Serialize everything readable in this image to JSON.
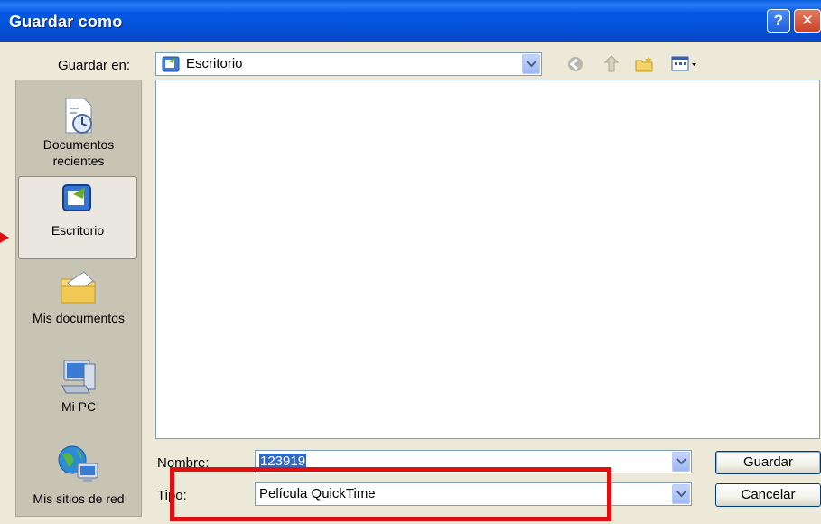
{
  "window": {
    "title": "Guardar como"
  },
  "toolbar": {
    "save_in_label": "Guardar en:",
    "save_in_value": "Escritorio"
  },
  "places": [
    {
      "label": "Documentos\nrecientes"
    },
    {
      "label": "Escritorio"
    },
    {
      "label": "Mis documentos"
    },
    {
      "label": "Mi PC"
    },
    {
      "label": "Mis sitios de red"
    }
  ],
  "form": {
    "name_label": "Nombre:",
    "name_value": "123919",
    "type_label": "Tipo:",
    "type_value": "Película QuickTime"
  },
  "buttons": {
    "save": "Guardar",
    "cancel": "Cancelar"
  },
  "colors": {
    "titlebar": "#0a50d6",
    "annotation": "#e01010",
    "selection": "#316ac5"
  }
}
